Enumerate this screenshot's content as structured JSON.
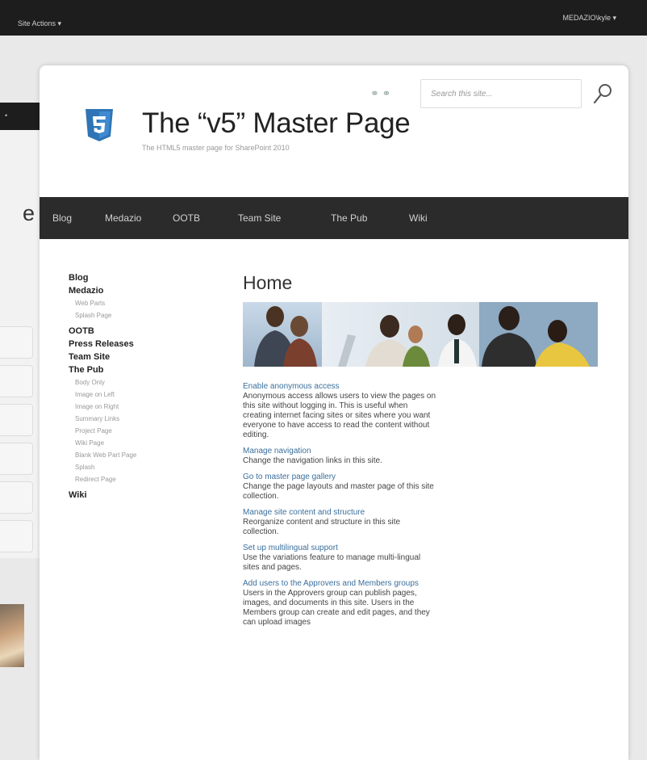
{
  "topbar": {
    "site_actions": "Site Actions ▾",
    "user": "MEDAZIO\\kyle ▾"
  },
  "ghost": {
    "bar_text": "•",
    "title_fragment": "e"
  },
  "header": {
    "title": "The “v5” Master Page",
    "subtitle": "The HTML5 master page for SharePoint 2010",
    "search_placeholder": "Search this site...",
    "icons_text": "⚭ ⚭"
  },
  "topnav": [
    "Blog",
    "Medazio",
    "OOTB",
    "Team Site",
    "The Pub",
    "Wiki"
  ],
  "quicklaunch": {
    "blog": "Blog",
    "medazio": "Medazio",
    "medazio_sub": [
      "Web Parts",
      "Splash Page"
    ],
    "ootb": "OOTB",
    "press": "Press Releases",
    "team": "Team Site",
    "pub": "The Pub",
    "pub_sub": [
      "Body Only",
      "Image on Left",
      "Image on Right",
      "Summary Links",
      "Project Page",
      "Wiki Page",
      "Blank Web Part Page",
      "Splash",
      "Redirect Page"
    ],
    "wiki": "Wiki"
  },
  "content": {
    "title": "Home",
    "items": [
      {
        "link": "Enable anonymous access",
        "desc": "Anonymous access allows users to view the pages on this site without logging in. This is useful when creating internet facing sites or sites where you want everyone to have access to read the content without editing."
      },
      {
        "link": "Manage navigation",
        "desc": "Change the navigation links in this site."
      },
      {
        "link": "Go to master page gallery",
        "desc": "Change the page layouts and master page of this site collection."
      },
      {
        "link": "Manage site content and structure",
        "desc": "Reorganize content and structure in this site collection."
      },
      {
        "link": "Set up multilingual support",
        "desc": "Use the variations feature to manage multi-lingual sites and pages."
      },
      {
        "link": "Add users to the Approvers and Members groups",
        "desc": "Users in the Approvers group can publish pages, images, and documents in this site. Users in the Members group can create and edit pages, and they can upload images"
      }
    ]
  },
  "colors": {
    "topbar": "#1d1d1d",
    "nav": "#2b2b2b",
    "link": "#3a6f9c",
    "logo": "#2f75b5"
  }
}
